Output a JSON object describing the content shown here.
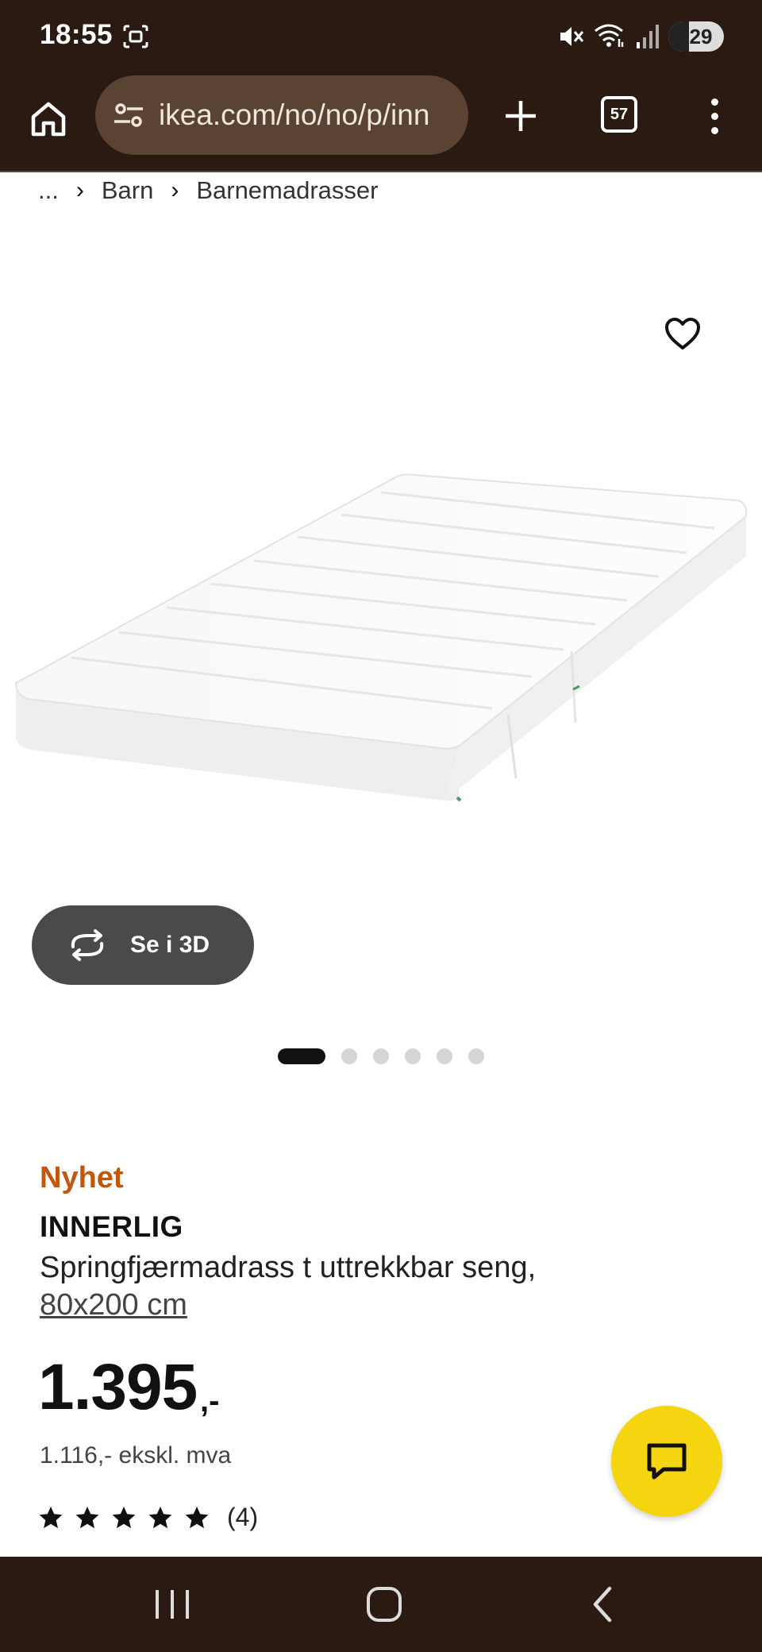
{
  "status_bar": {
    "time": "18:55",
    "battery": "29",
    "icons": [
      "screenshot-icon",
      "mute-icon",
      "wifi-icon",
      "signal-icon",
      "battery-icon"
    ]
  },
  "browser": {
    "url": "ikea.com/no/no/p/inn",
    "tab_count": "57",
    "icons": [
      "home-icon",
      "site-settings-icon",
      "plus-icon",
      "tabs-icon",
      "more-icon"
    ]
  },
  "breadcrumb": {
    "ellipsis": "...",
    "items": [
      "Barn",
      "Barnemadrasser"
    ]
  },
  "gallery": {
    "view3d_label": "Se i 3D",
    "slide_count": 6,
    "active_slide": 1
  },
  "product": {
    "badge": "Nyhet",
    "name": "INNERLIG",
    "description": "Springfjærmadrass t uttrekkbar seng,",
    "size": "80x200 cm",
    "price": "1.395",
    "price_suffix": ",-",
    "price_ex_vat": "1.116,- ekskl. mva",
    "rating_stars": 5,
    "rating_count": "(4)"
  },
  "colors": {
    "chrome": "#2a1a12",
    "url_pill": "#5a4333",
    "badge": "#c2570c",
    "fab": "#f5d50f"
  }
}
